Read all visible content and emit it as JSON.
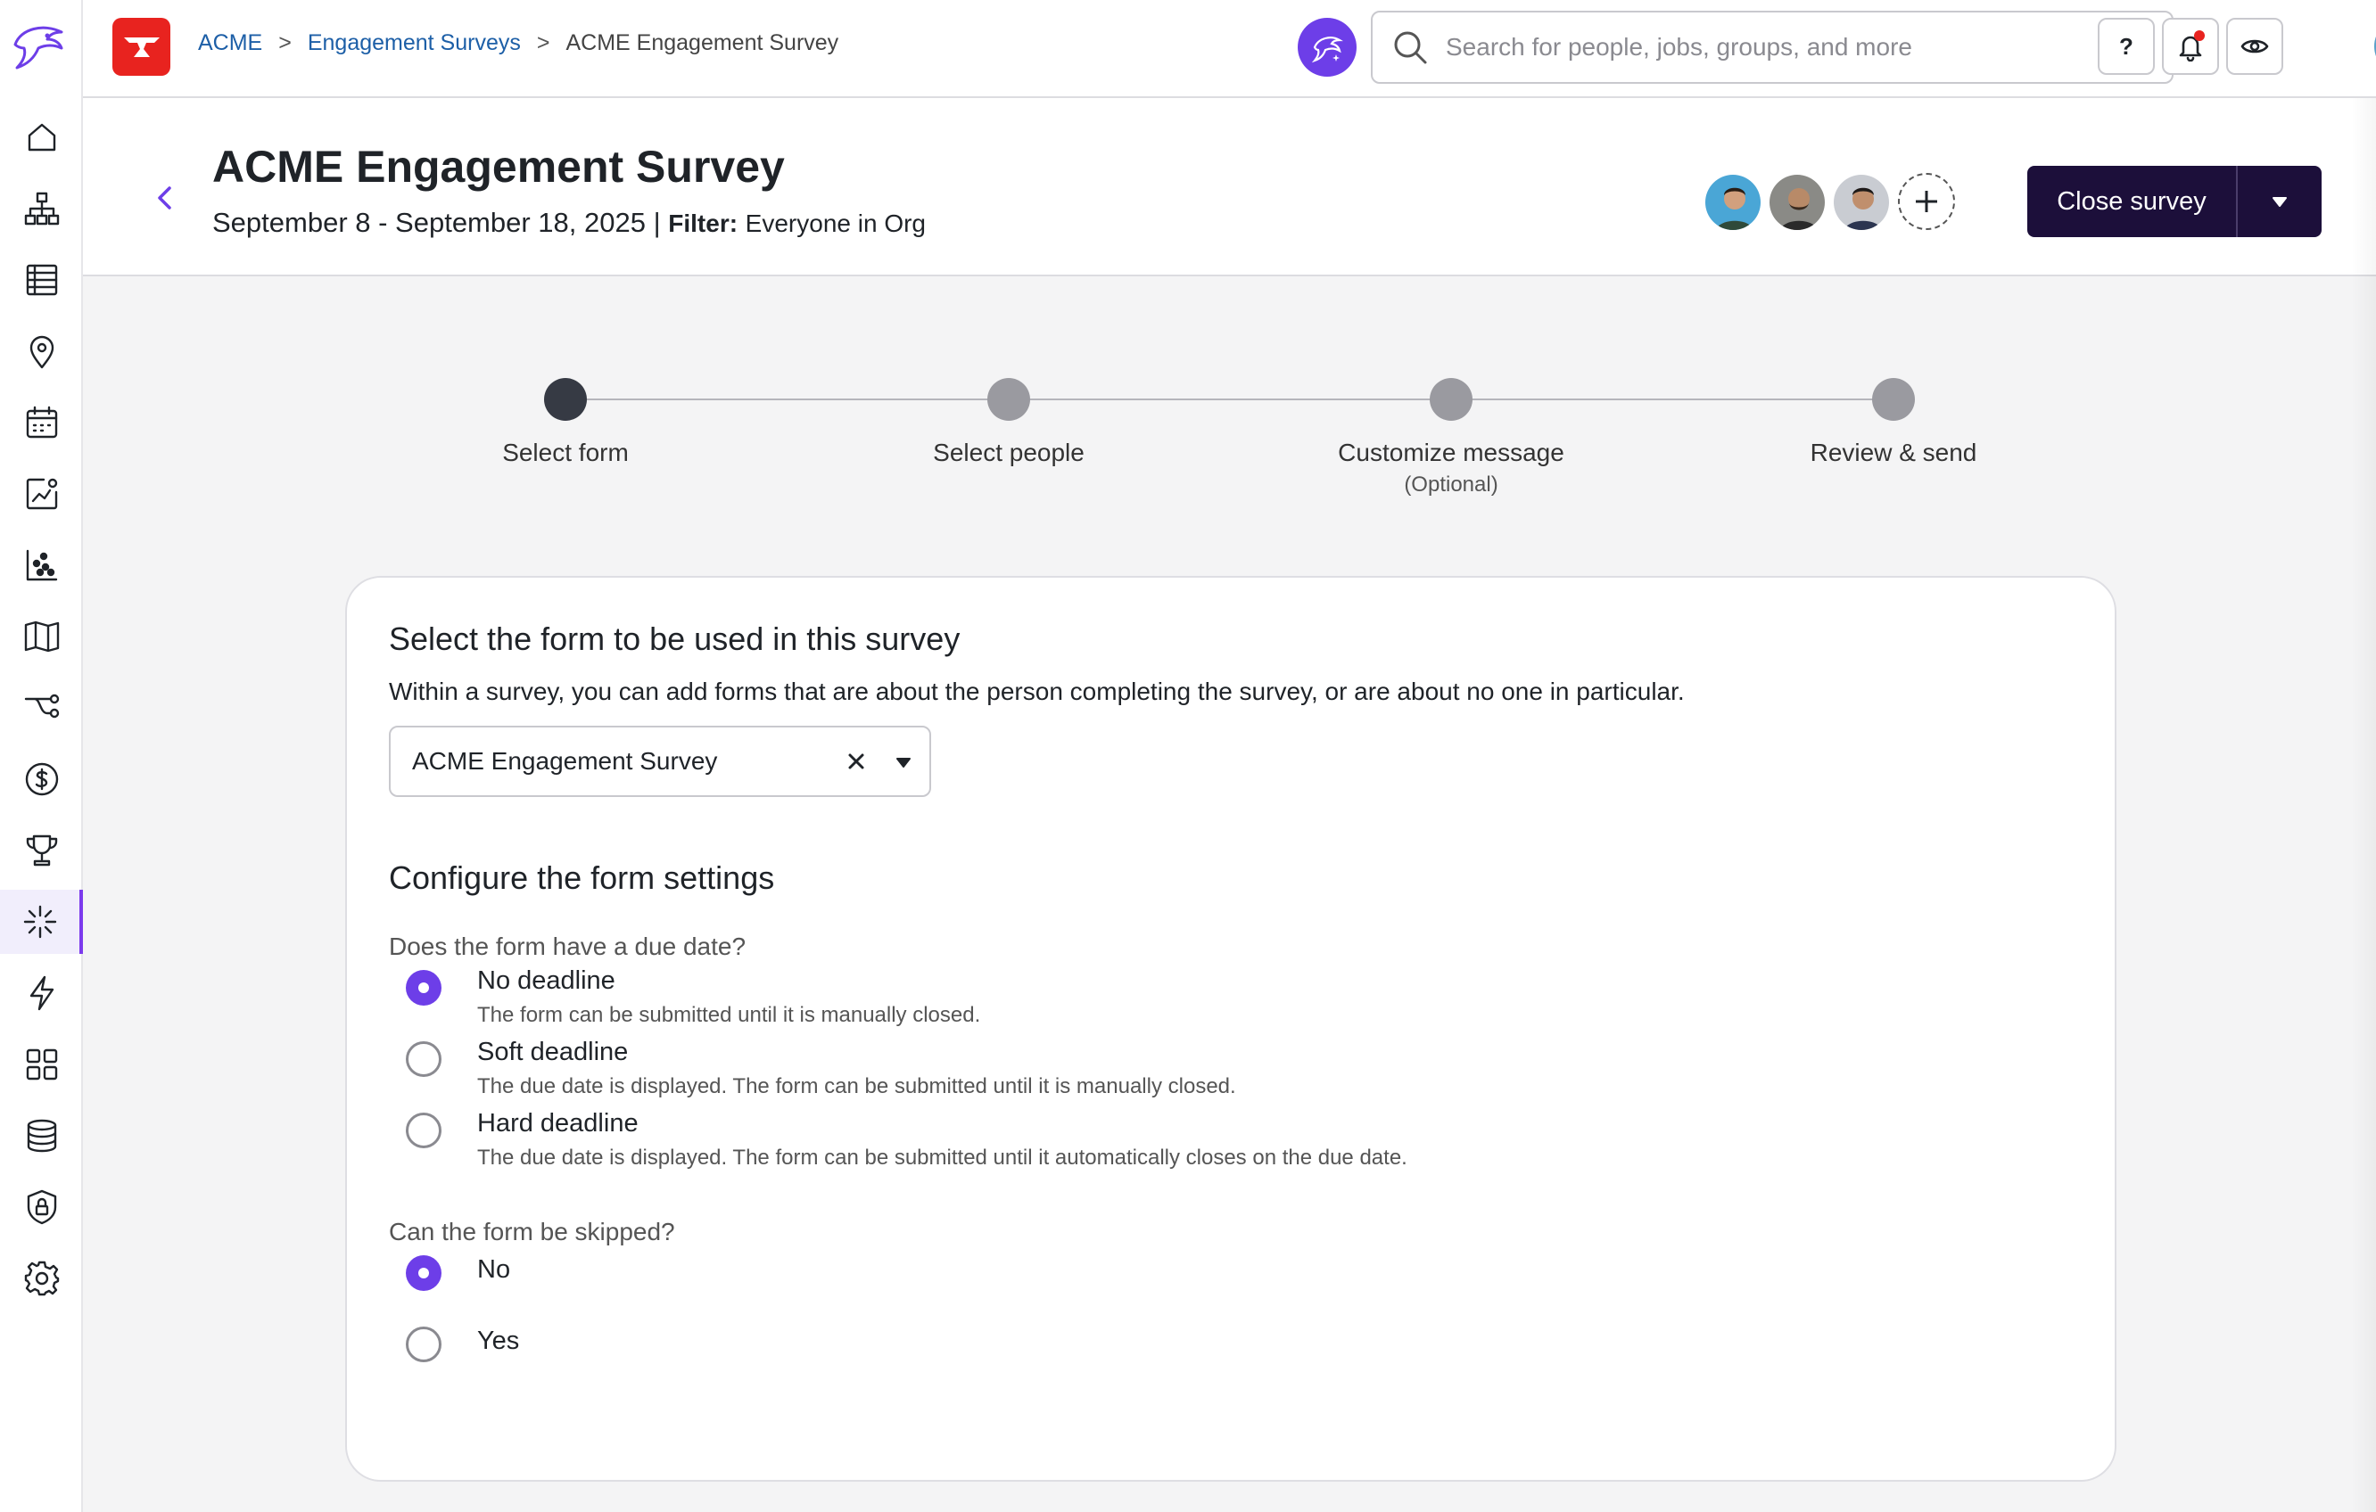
{
  "topbar": {
    "breadcrumb": [
      "ACME",
      "Engagement Surveys",
      "ACME Engagement Survey"
    ],
    "breadcrumb_sep": ">",
    "search_placeholder": "Search for people, jobs, groups, and more",
    "help_label": "?"
  },
  "header": {
    "title": "ACME Engagement Survey",
    "dates": "September 8 - September 18, 2025 |",
    "filter_label": "Filter:",
    "filter_value": "Everyone in Org",
    "close_button": "Close survey"
  },
  "stepper": {
    "steps": [
      {
        "label": "Select form",
        "sub": "",
        "state": "active"
      },
      {
        "label": "Select people",
        "sub": "",
        "state": "pending"
      },
      {
        "label": "Customize message",
        "sub": "(Optional)",
        "state": "pending"
      },
      {
        "label": "Review & send",
        "sub": "",
        "state": "pending"
      }
    ]
  },
  "form_select": {
    "heading": "Select the form to be used in this survey",
    "description": "Within a survey, you can add forms that are about the person completing the survey, or are about no one in particular.",
    "selected": "ACME Engagement Survey"
  },
  "settings": {
    "heading": "Configure the form settings",
    "due_date_question": "Does the form have a due date?",
    "due_date_options": [
      {
        "title": "No deadline",
        "subtitle": "The form can be submitted until it is manually closed.",
        "checked": true
      },
      {
        "title": "Soft deadline",
        "subtitle": "The due date is displayed. The form can be submitted until it is manually closed.",
        "checked": false
      },
      {
        "title": "Hard deadline",
        "subtitle": "The due date is displayed. The form can be submitted until it automatically closes on the due date.",
        "checked": false
      }
    ],
    "skip_question": "Can the form be skipped?",
    "skip_options": [
      {
        "title": "No",
        "checked": true
      },
      {
        "title": "Yes",
        "checked": false
      }
    ]
  },
  "colors": {
    "accent": "#6d3ee8",
    "primary_button": "#1c0f3a",
    "brand_red": "#e8231f",
    "link": "#1d5fa7"
  },
  "icons": {
    "rail": [
      "home-icon",
      "org-chart-icon",
      "table-icon",
      "location-icon",
      "calendar-icon",
      "analytics-icon",
      "scatter-chart-icon",
      "book-icon",
      "workflow-icon",
      "dollar-icon",
      "trophy-icon",
      "sparkle-icon",
      "lightning-icon",
      "apps-grid-icon",
      "database-icon",
      "shield-lock-icon",
      "gear-icon"
    ]
  }
}
